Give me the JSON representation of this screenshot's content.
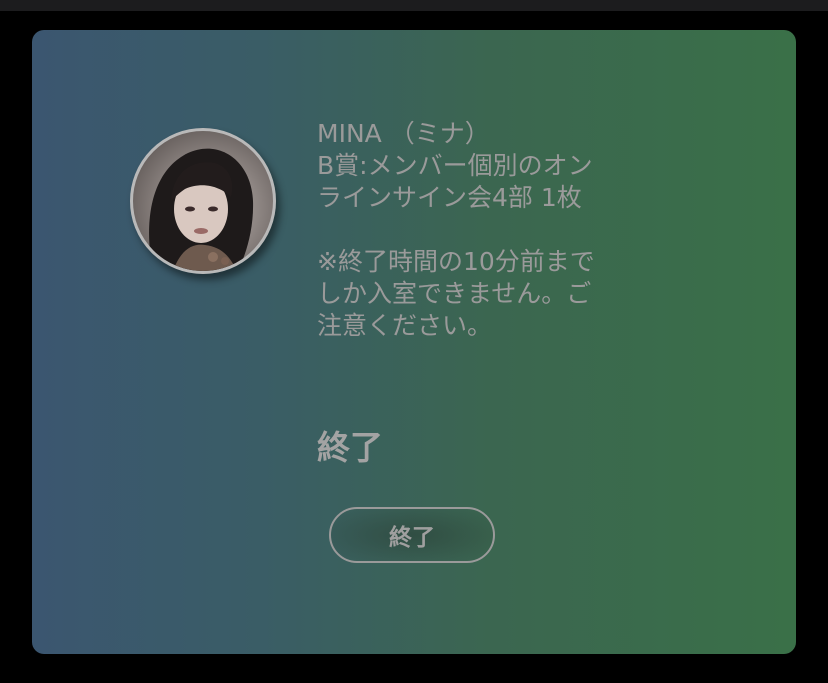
{
  "card": {
    "member_name": "MINA （ミナ）",
    "prize_line1": "B賞:メンバー個別のオン",
    "prize_line2": "ラインサイン会4部 1枚",
    "note_line1": "※終了時間の10分前まで",
    "note_line2": "しか入室できません。ご",
    "note_line3": "注意ください。",
    "status_label": "終了",
    "button_label": "終了"
  },
  "icons": {
    "avatar": "member-photo"
  },
  "colors": {
    "background": "#000000",
    "gradient_left": "#3b5670",
    "gradient_right": "#3a7048",
    "text": "#9a9a9a"
  }
}
